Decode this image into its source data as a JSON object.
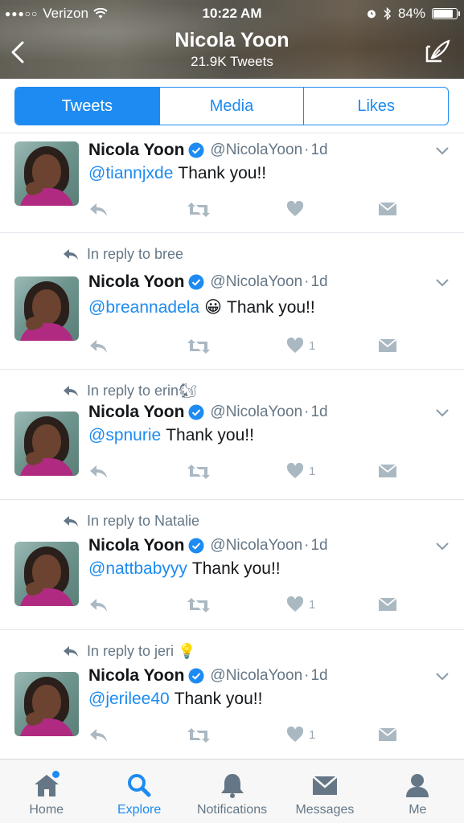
{
  "status_bar": {
    "carrier": "Verizon",
    "signal_dots": "●●●○○",
    "time": "10:22 AM",
    "battery": "84%",
    "battery_level": 0.84
  },
  "header": {
    "name": "Nicola Yoon",
    "tweet_count": "21.9K Tweets"
  },
  "tabs": [
    {
      "label": "Tweets",
      "active": true
    },
    {
      "label": "Media",
      "active": false
    },
    {
      "label": "Likes",
      "active": false
    }
  ],
  "tweets": [
    {
      "reply_to": "",
      "reply_emoji": "",
      "name": "Nicola Yoon",
      "handle": "@NicolaYoon",
      "time": "1d",
      "mention": "@tiannjxde",
      "emoji": "",
      "text": "Thank you!!",
      "likes": ""
    },
    {
      "reply_to": "In reply to bree",
      "reply_emoji": "",
      "name": "Nicola Yoon",
      "handle": "@NicolaYoon",
      "time": "1d",
      "mention": "@breannadela",
      "emoji": "😀",
      "text": "Thank you!!",
      "likes": "1"
    },
    {
      "reply_to": "In reply to erin",
      "reply_emoji": "🐿",
      "name": "Nicola Yoon",
      "handle": "@NicolaYoon",
      "time": "1d",
      "mention": "@spnurie",
      "emoji": "",
      "text": "Thank you!!",
      "likes": "1"
    },
    {
      "reply_to": "In reply to Natalie",
      "reply_emoji": "",
      "name": "Nicola Yoon",
      "handle": "@NicolaYoon",
      "time": "1d",
      "mention": "@nattbabyyy",
      "emoji": "",
      "text": "Thank you!!",
      "likes": "1"
    },
    {
      "reply_to": "In reply to jeri",
      "reply_emoji": "💡",
      "name": "Nicola Yoon",
      "handle": "@NicolaYoon",
      "time": "1d",
      "mention": "@jerilee40",
      "emoji": "",
      "text": "Thank you!!",
      "likes": "1"
    }
  ],
  "tabbar": [
    {
      "label": "Home",
      "icon": "home-icon",
      "active": false
    },
    {
      "label": "Explore",
      "icon": "search-icon",
      "active": true
    },
    {
      "label": "Notifications",
      "icon": "bell-icon",
      "active": false
    },
    {
      "label": "Messages",
      "icon": "envelope-icon",
      "active": false
    },
    {
      "label": "Me",
      "icon": "person-icon",
      "active": false
    }
  ],
  "colors": {
    "accent": "#1d8bf1",
    "text": "#14171a",
    "secondary": "#657786"
  }
}
